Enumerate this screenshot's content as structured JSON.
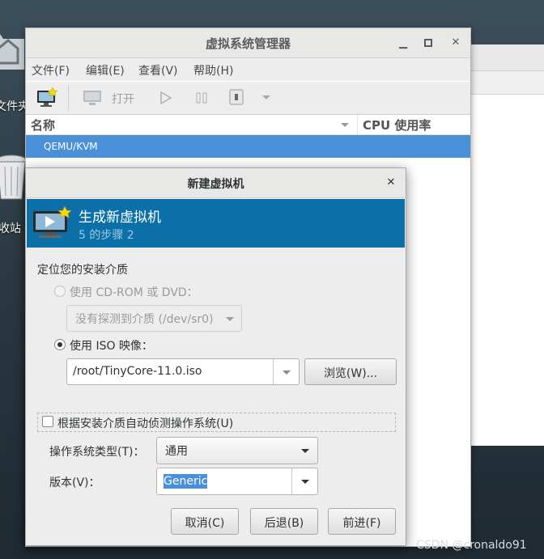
{
  "desktop": {
    "folder_label": "文件夹",
    "trash_label": "收站"
  },
  "manager": {
    "title": "虚拟系统管理器",
    "menu": [
      "文件(F)",
      "编辑(E)",
      "查看(V)",
      "帮助(H)"
    ],
    "toolbar": {
      "open_label": "打开"
    },
    "columns": {
      "name": "名称",
      "cpu": "CPU 使用率"
    },
    "rows": [
      {
        "name": "QEMU/KVM"
      }
    ]
  },
  "dialog": {
    "title": "新建虚拟机",
    "header_title": "生成新虚拟机",
    "header_step": "5 的步骤 2",
    "locate_label": "定位您的安装介质",
    "cdrom_radio_label": "使用 CD-ROM 或 DVD：",
    "cdrom_combo_value": "没有探测到介质 (/dev/sr0)",
    "iso_radio_label": "使用 ISO 映像：",
    "iso_path": "/root/TinyCore-11.0.iso",
    "browse_button": "浏览(W)...",
    "autodetect_label": "根据安装介质自动侦测操作系统(U)",
    "os_type_label": "操作系统类型(T)：",
    "os_type_value": "通用",
    "version_label": "版本(V)：",
    "version_value": "Generic",
    "cancel_button": "取消(C)",
    "back_button": "后退(B)",
    "forward_button": "前进(F)",
    "selected_radio": "iso",
    "autodetect_checked": false
  },
  "watermark": "CSDN @cronaldo91",
  "colors": {
    "banner": "#0b70a8",
    "selection": "#4a90d9"
  },
  "icons": [
    "folder-icon",
    "trash-icon",
    "new-vm-icon",
    "monitor-icon",
    "play-icon",
    "pause-icon",
    "shutdown-icon",
    "close-icon",
    "minimize-icon",
    "maximize-icon",
    "chevron-down-icon"
  ]
}
